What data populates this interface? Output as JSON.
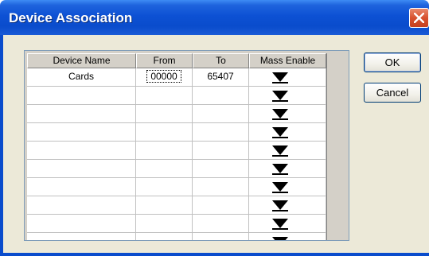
{
  "window": {
    "title": "Device Association"
  },
  "grid": {
    "columns": [
      "Device Name",
      "From",
      "To",
      "Mass Enable"
    ],
    "rows": [
      {
        "device_name": "Cards",
        "from": "00000",
        "to": "65407"
      },
      {
        "device_name": "",
        "from": "",
        "to": ""
      },
      {
        "device_name": "",
        "from": "",
        "to": ""
      },
      {
        "device_name": "",
        "from": "",
        "to": ""
      },
      {
        "device_name": "",
        "from": "",
        "to": ""
      },
      {
        "device_name": "",
        "from": "",
        "to": ""
      },
      {
        "device_name": "",
        "from": "",
        "to": ""
      },
      {
        "device_name": "",
        "from": "",
        "to": ""
      },
      {
        "device_name": "",
        "from": "",
        "to": ""
      },
      {
        "device_name": "",
        "from": "",
        "to": ""
      }
    ]
  },
  "buttons": {
    "ok": "OK",
    "cancel": "Cancel"
  },
  "icons": {
    "close": "close-icon",
    "dropdown": "dropdown-arrow-icon"
  },
  "colors": {
    "titlebar": "#0a4ccc",
    "close": "#d8512f",
    "client": "#ece9d8"
  }
}
